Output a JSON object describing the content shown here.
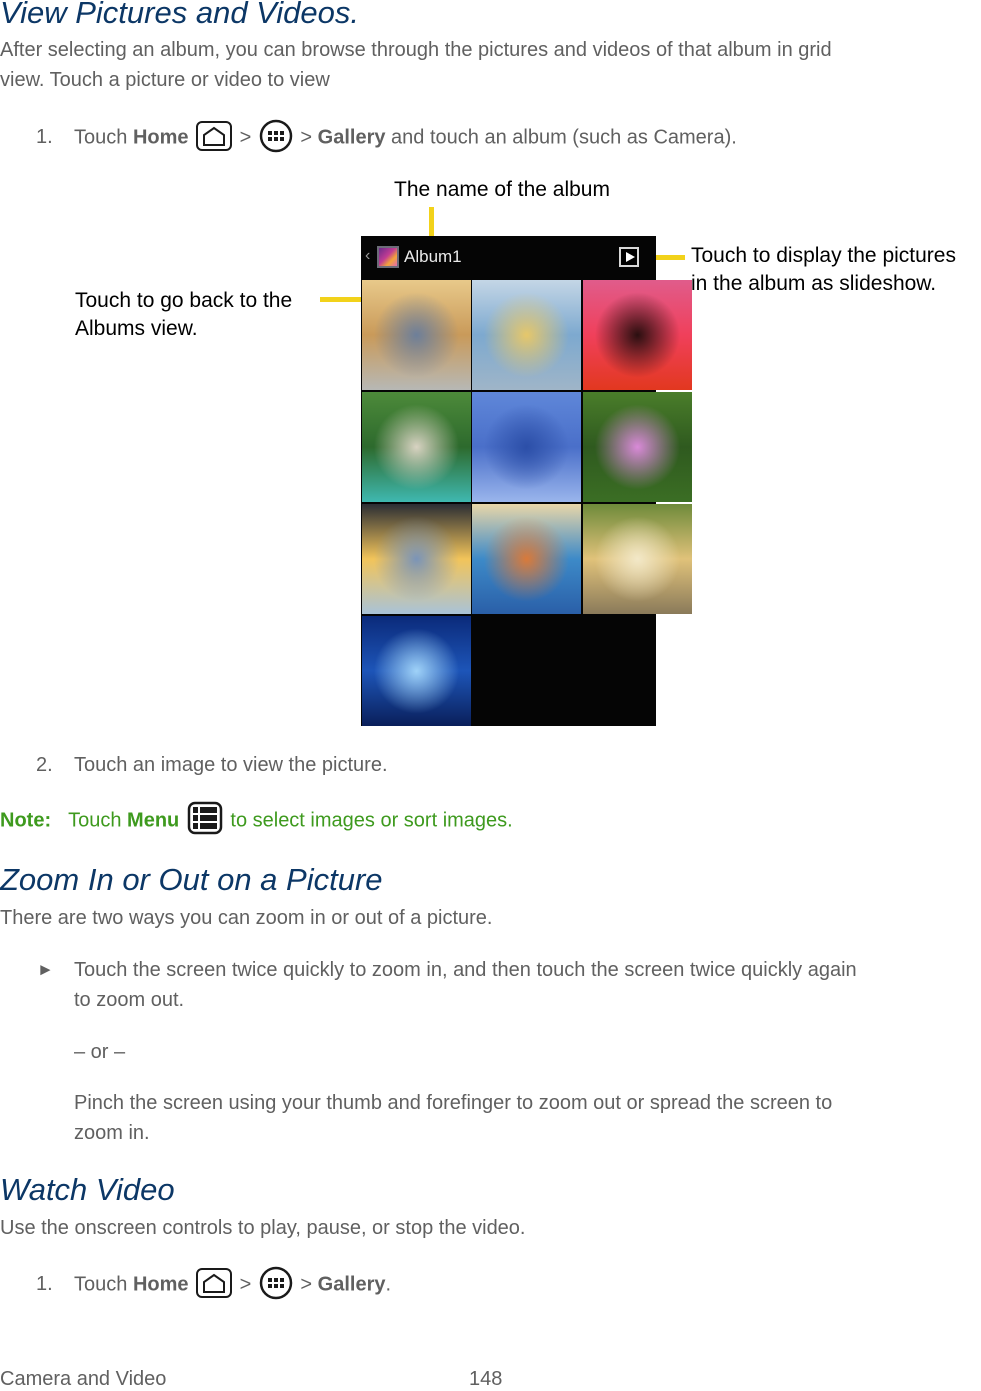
{
  "sections": {
    "view_pictures": {
      "heading": "View Pictures and Videos.",
      "intro_line1": "After selecting an album, you can browse through the pictures and videos of that album in grid",
      "intro_line2": "view. Touch a picture or video to view",
      "step1": {
        "number": "1.",
        "prefix": "Touch ",
        "home_label": "Home",
        "separator": " > ",
        "gallery_label": "Gallery",
        "suffix": " and touch an album (such as Camera)."
      },
      "figure": {
        "callout_album_name": "The name of the album",
        "callout_back_line1": "Touch to go back to the",
        "callout_back_line2": "Albums view.",
        "callout_slideshow_line1": "Touch to display the pictures",
        "callout_slideshow_line2": "in the album as slideshow.",
        "phone": {
          "back_chevron": "‹",
          "album_title": "Album1",
          "icons": [
            "album-thumbnail-icon",
            "play-slideshow-icon"
          ],
          "thumbnails": [
            {
              "name": "sunset-sea-boat",
              "colors": [
                "#e8c98a",
                "#c99a5a",
                "#6d7f9a",
                "#b7b8b5"
              ]
            },
            {
              "name": "hand-sanitizer-bottle",
              "colors": [
                "#c4d6e6",
                "#7da9cf",
                "#e6c76a",
                "#9fb5c8"
              ]
            },
            {
              "name": "red-sunset",
              "colors": [
                "#e05c8b",
                "#f0405b",
                "#2a0f10",
                "#e2381f"
              ]
            },
            {
              "name": "coastal-cove",
              "colors": [
                "#4d8a3a",
                "#2d6a2d",
                "#d8d3c2",
                "#3fb8b0"
              ]
            },
            {
              "name": "beads-illustration",
              "colors": [
                "#5f87d9",
                "#4a6fc9",
                "#2c4fa8",
                "#9ab5ec"
              ]
            },
            {
              "name": "water-lilies",
              "colors": [
                "#4a7d2a",
                "#2f5a1f",
                "#d98ad8",
                "#3b6e24"
              ]
            },
            {
              "name": "palm-beach-sunset",
              "colors": [
                "#2a2d33",
                "#f2c45a",
                "#7a94b8",
                "#a9c3d8"
              ]
            },
            {
              "name": "mosaic-beads",
              "colors": [
                "#e8d6a8",
                "#3d8ac8",
                "#d97a3a",
                "#2a5fa8"
              ]
            },
            {
              "name": "villa-garden",
              "colors": [
                "#6e8a3a",
                "#e0c27a",
                "#f2e8c8",
                "#8a7a5a"
              ]
            },
            {
              "name": "underwater-sunburst",
              "colors": [
                "#0b2a7a",
                "#1d55b8",
                "#9fd2f8",
                "#0a1f5a"
              ]
            }
          ]
        }
      },
      "step2": {
        "number": "2.",
        "text": "Touch an image to view the picture."
      },
      "note": {
        "label": "Note:",
        "prefix": "Touch ",
        "menu_label": "Menu",
        "suffix": " to select images or sort images."
      }
    },
    "zoom": {
      "heading": "Zoom In or Out on a Picture",
      "intro": "There are two ways you can zoom in or out of a picture.",
      "bullet_glyph": "►",
      "option1_line1": "Touch the screen twice quickly to zoom in, and then touch the screen twice quickly again",
      "option1_line2": "to zoom out.",
      "or_text": "– or –",
      "option2_line1": "Pinch the screen using your thumb and forefinger to zoom out or spread the screen to",
      "option2_line2": "zoom in."
    },
    "watch_video": {
      "heading": "Watch Video",
      "intro": "Use the onscreen controls to play, pause, or stop the video.",
      "step1": {
        "number": "1.",
        "prefix": "Touch ",
        "home_label": "Home",
        "separator": " > ",
        "gallery_label": "Gallery",
        "suffix": "."
      }
    }
  },
  "footer": {
    "section_name": "Camera and Video",
    "page_number": "148"
  },
  "colors": {
    "heading": "#0c3766",
    "body": "#606060",
    "note": "#3e9a1e",
    "callout_line": "#f2d21a"
  }
}
